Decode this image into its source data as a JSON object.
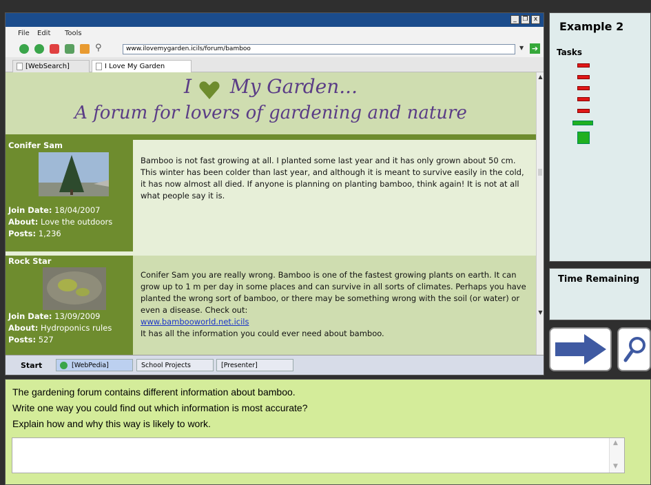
{
  "browser": {
    "menu": [
      "File",
      "Edit",
      "Tools"
    ],
    "window_buttons": [
      "_",
      "❐",
      "x"
    ],
    "url": "www.ilovemygarden.icils/forum/bamboo",
    "tabs": [
      "[WebSearch]",
      "I Love My Garden"
    ]
  },
  "forum": {
    "title_line1_left": "I",
    "title_line1_right": "My Garden...",
    "title_line2": "A forum for lovers of gardening and nature",
    "posts": [
      {
        "username": "Conifer Sam",
        "join_label": "Join Date:",
        "join_date": "18/04/2007",
        "about_label": "About:",
        "about": "Love the outdoors",
        "posts_label": "Posts:",
        "posts": "1,236",
        "message": "Bamboo is not fast growing at all. I planted some last year and it has only grown about 50 cm. This winter has been colder than last year, and although it is meant to survive easily in the cold, it has now almost all died. If anyone is planning on planting bamboo, think again! It is not at all what people say it is."
      },
      {
        "username": "Rock Star",
        "join_label": "Join Date:",
        "join_date": "13/09/2009",
        "about_label": "About:",
        "about": "Hydroponics rules",
        "posts_label": "Posts:",
        "posts": "527",
        "message": "Conifer Sam you are really wrong. Bamboo is one of the fastest growing plants on earth. It can grow up to 1 m per day in some places and can survive in all sorts of climates. Perhaps you have planted the wrong sort of bamboo, or there may be something wrong with the soil (or water) or even a disease. Check out:",
        "link": "www.bambooworld.net.icils",
        "message_end": "It has all the information you could ever need about bamboo."
      }
    ]
  },
  "taskbar": {
    "start": "Start",
    "items": [
      "[WebPedia]",
      "School Projects",
      "[Presenter]"
    ]
  },
  "side_panel": {
    "example_title": "Example 2",
    "tasks_label": "Tasks",
    "task_status": [
      "incomplete",
      "incomplete",
      "incomplete",
      "incomplete",
      "incomplete",
      "current",
      "upcoming"
    ],
    "time_label": "Time Remaining"
  },
  "question": {
    "line1": "The gardening forum contains different information about bamboo.",
    "line2": "Write one way you could find out which information is most accurate?",
    "line3": "Explain how and why this way is likely to work.",
    "answer": ""
  },
  "colors": {
    "title_purple": "#5a3c86",
    "sidebar_green": "#6e8c2e",
    "question_bg": "#d4ec9a",
    "next_arrow": "#3f5aa2"
  }
}
